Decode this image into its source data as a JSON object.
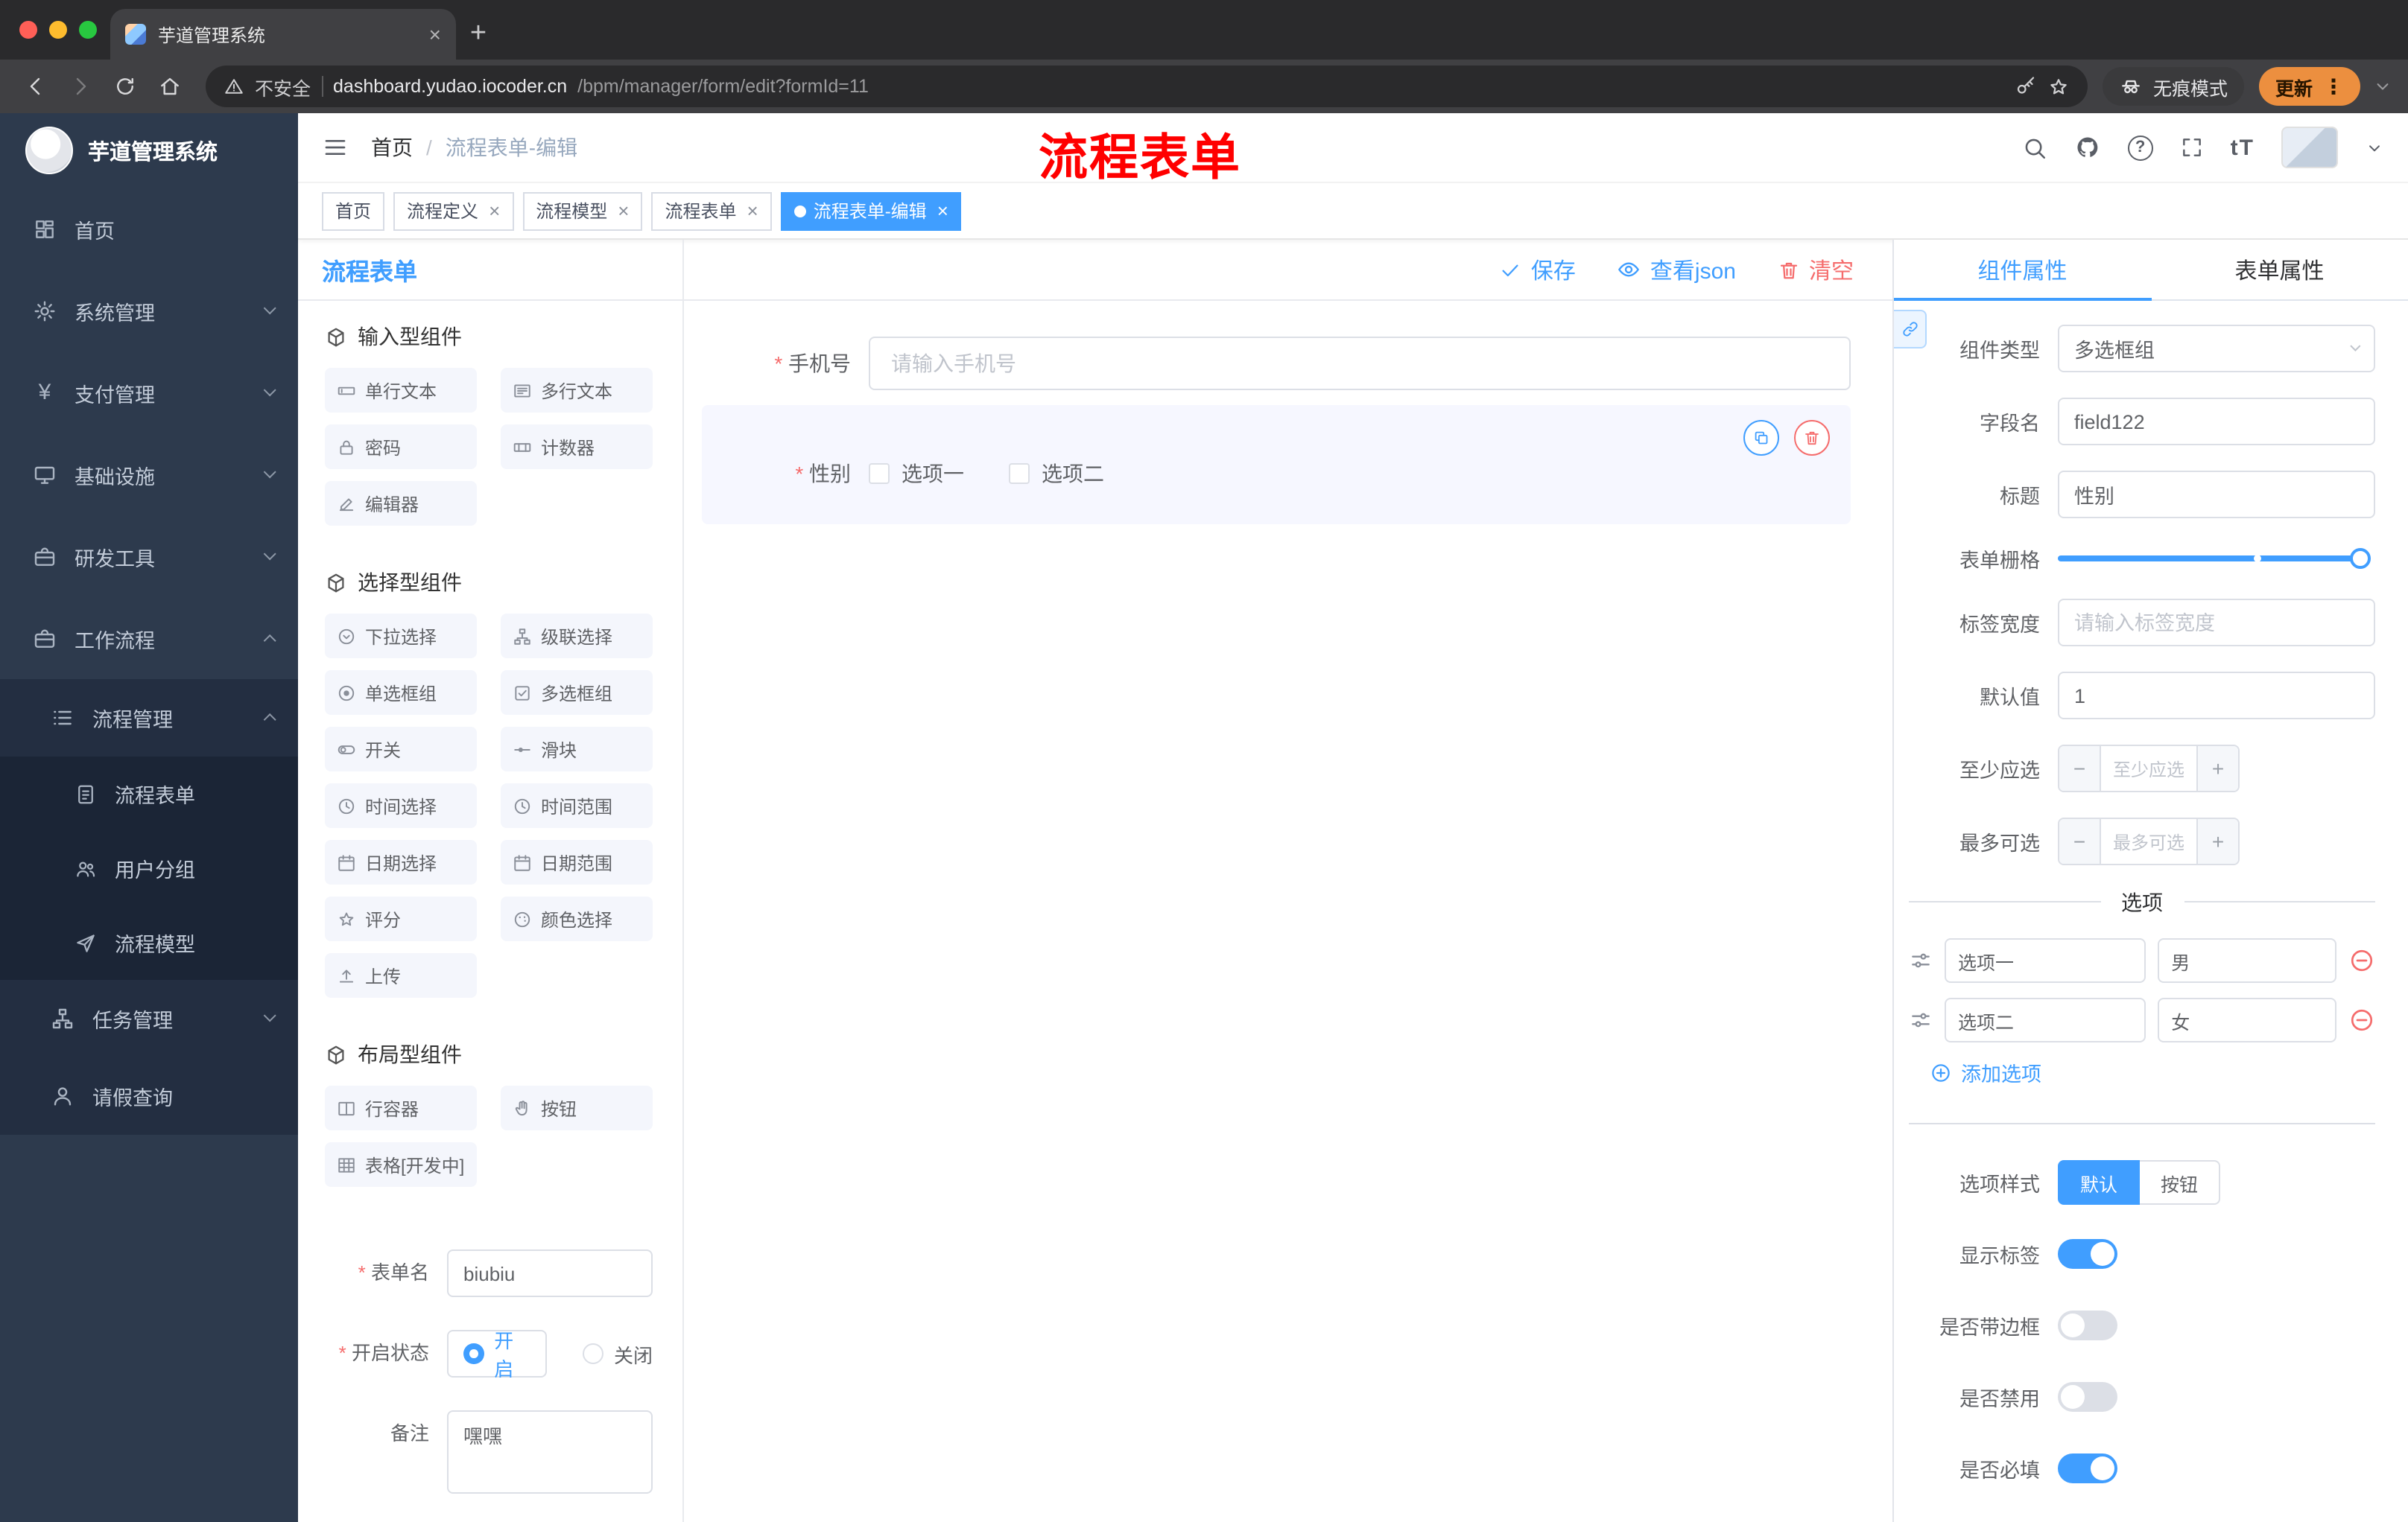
{
  "browser": {
    "tab_title": "芋道管理系统",
    "not_secure": "不安全",
    "url_host": "dashboard.yudao.iocoder.cn",
    "url_path": "/bpm/manager/form/edit?formId=11",
    "incognito": "无痕模式",
    "update": "更新",
    "icons": [
      "warning-icon",
      "key-icon",
      "star-icon",
      "incognito-icon",
      "kebab-menu-icon"
    ]
  },
  "sidebar": {
    "title": "芋道管理系统",
    "items": [
      {
        "label": "首页",
        "icon": "dashboard-icon"
      },
      {
        "label": "系统管理",
        "icon": "gear-icon"
      },
      {
        "label": "支付管理",
        "icon": "yen-icon"
      },
      {
        "label": "基础设施",
        "icon": "monitor-icon"
      },
      {
        "label": "研发工具",
        "icon": "briefcase-icon"
      },
      {
        "label": "工作流程",
        "icon": "workflow-icon"
      }
    ],
    "process_mgmt": "流程管理",
    "process_children": [
      {
        "label": "流程表单",
        "icon": "form-icon"
      },
      {
        "label": "用户分组",
        "icon": "user-group-icon"
      },
      {
        "label": "流程模型",
        "icon": "send-icon"
      }
    ],
    "task_mgmt": "任务管理",
    "leave_query": "请假查询"
  },
  "header": {
    "breadcrumb_home": "首页",
    "breadcrumb_sep": "/",
    "breadcrumb_current": "流程表单-编辑",
    "annotation": "流程表单",
    "icons": [
      "search-icon",
      "github-icon",
      "question-icon",
      "fullscreen-icon",
      "font-size-icon",
      "avatar",
      "caret-down-icon"
    ]
  },
  "tags": [
    {
      "label": "首页"
    },
    {
      "label": "流程定义"
    },
    {
      "label": "流程模型"
    },
    {
      "label": "流程表单"
    },
    {
      "label": "流程表单-编辑"
    }
  ],
  "designer": {
    "title": "流程表单",
    "save": "保存",
    "view_json": "查看json",
    "clear": "清空",
    "sections": [
      {
        "title": "输入型组件",
        "items": [
          {
            "label": "单行文本",
            "icon": "text-input-icon"
          },
          {
            "label": "多行文本",
            "icon": "textarea-icon"
          },
          {
            "label": "密码",
            "icon": "lock-icon"
          },
          {
            "label": "计数器",
            "icon": "counter-icon"
          },
          {
            "label": "编辑器",
            "icon": "editor-icon"
          }
        ]
      },
      {
        "title": "选择型组件",
        "items": [
          {
            "label": "下拉选择",
            "icon": "select-icon"
          },
          {
            "label": "级联选择",
            "icon": "cascade-icon"
          },
          {
            "label": "单选框组",
            "icon": "radio-icon"
          },
          {
            "label": "多选框组",
            "icon": "checkbox-icon"
          },
          {
            "label": "开关",
            "icon": "switch-icon"
          },
          {
            "label": "滑块",
            "icon": "slider-icon"
          },
          {
            "label": "时间选择",
            "icon": "clock-icon"
          },
          {
            "label": "时间范围",
            "icon": "clock-range-icon"
          },
          {
            "label": "日期选择",
            "icon": "calendar-icon"
          },
          {
            "label": "日期范围",
            "icon": "calendar-range-icon"
          },
          {
            "label": "评分",
            "icon": "star-icon"
          },
          {
            "label": "颜色选择",
            "icon": "palette-icon"
          },
          {
            "label": "上传",
            "icon": "upload-icon"
          }
        ]
      },
      {
        "title": "布局型组件",
        "items": [
          {
            "label": "行容器",
            "icon": "row-container-icon"
          },
          {
            "label": "按钮",
            "icon": "button-hand-icon"
          },
          {
            "label": "表格[开发中]",
            "icon": "table-icon"
          }
        ]
      }
    ],
    "meta": {
      "name_label": "表单名",
      "name_value": "biubiu",
      "status_label": "开启状态",
      "on": "开启",
      "off": "关闭",
      "remark_label": "备注",
      "remark_value": "嘿嘿"
    },
    "canvas": {
      "phone_label": "手机号",
      "phone_placeholder": "请输入手机号",
      "gender_label": "性别",
      "opt1": "选项一",
      "opt2": "选项二"
    }
  },
  "props": {
    "tab_component": "组件属性",
    "tab_form": "表单属性",
    "rows": {
      "type_label": "组件类型",
      "type_value": "多选框组",
      "field_label": "字段名",
      "field_value": "field122",
      "title_label": "标题",
      "title_value": "性别",
      "grid_label": "表单栅格",
      "width_label": "标签宽度",
      "width_placeholder": "请输入标签宽度",
      "default_label": "默认值",
      "default_value": "1",
      "min_label": "至少应选",
      "min_placeholder": "至少应选",
      "max_label": "最多可选",
      "max_placeholder": "最多可选"
    },
    "options_title": "选项",
    "options": [
      {
        "label": "选项一",
        "value": "男"
      },
      {
        "label": "选项二",
        "value": "女"
      }
    ],
    "add_option": "添加选项",
    "style_label": "选项样式",
    "style_options": [
      "默认",
      "按钮"
    ],
    "switch_rows": [
      {
        "label": "显示标签",
        "value": true
      },
      {
        "label": "是否带边框",
        "value": false
      },
      {
        "label": "是否禁用",
        "value": false
      },
      {
        "label": "是否必填",
        "value": true
      }
    ]
  },
  "colors": {
    "primary": "#409EFF",
    "danger": "#F56C6C",
    "annotation_red": "#FF0000",
    "sidebar_bg": "#2d3a4d",
    "update_pill": "#ec8f3f"
  }
}
